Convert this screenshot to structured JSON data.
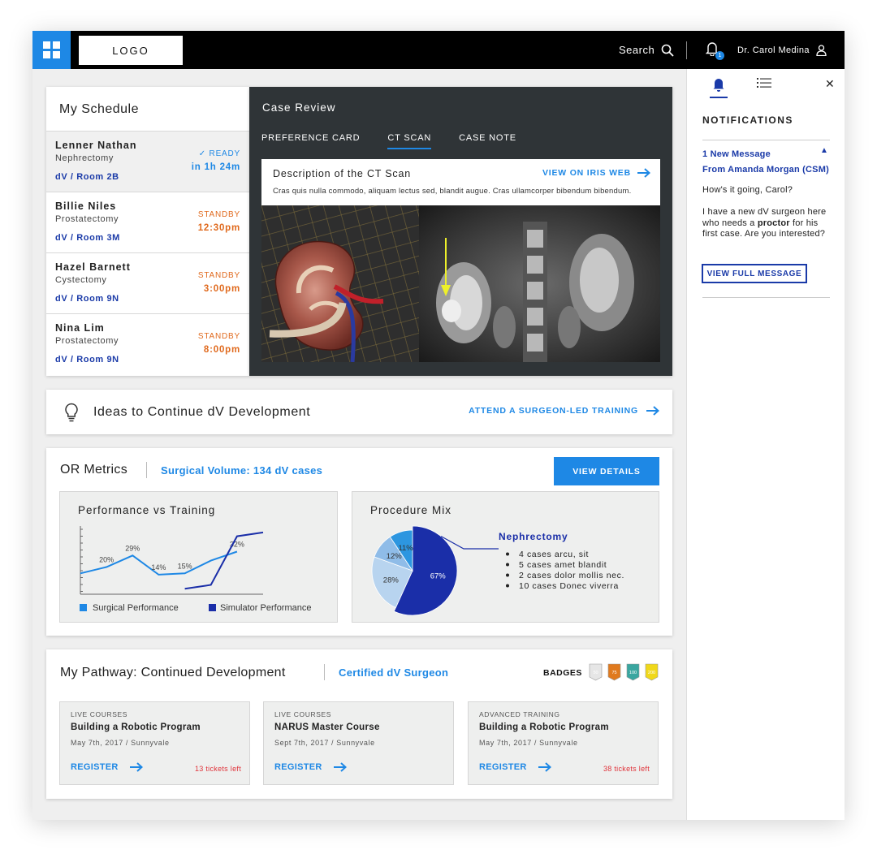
{
  "topbar": {
    "logo": "LOGO",
    "search_label": "Search",
    "notification_count": "1",
    "user_name": "Dr. Carol Medina"
  },
  "schedule": {
    "title": "My Schedule",
    "items": [
      {
        "name": "Lenner Nathan",
        "procedure": "Nephrectomy",
        "room": "dV / Room 2B",
        "status": "READY",
        "time": "in 1h 24m"
      },
      {
        "name": "Billie Niles",
        "procedure": "Prostatectomy",
        "room": "dV / Room 3M",
        "status": "STANDBY",
        "time": "12:30pm"
      },
      {
        "name": "Hazel Barnett",
        "procedure": "Cystectomy",
        "room": "dV / Room 9N",
        "status": "STANDBY",
        "time": "3:00pm"
      },
      {
        "name": "Nina Lim",
        "procedure": "Prostatectomy",
        "room": "dV / Room 9N",
        "status": "STANDBY",
        "time": "8:00pm"
      }
    ]
  },
  "case_review": {
    "title": "Case Review",
    "tabs": [
      "PREFERENCE CARD",
      "CT SCAN",
      "CASE NOTE"
    ],
    "active_tab": "CT SCAN",
    "desc_title": "Description of the CT Scan",
    "desc_link": "VIEW ON IRIS WEB",
    "desc_body": "Cras quis nulla commodo, aliquam lectus sed, blandit augue. Cras ullamcorper bibendum bibendum."
  },
  "ideas": {
    "title": "Ideas to Continue dV Development",
    "link": "ATTEND A SURGEON-LED TRAINING"
  },
  "metrics": {
    "title": "OR Metrics",
    "surgical_volume": "Surgical Volume: 134 dV cases",
    "button": "VIEW DETAILS",
    "line_title": "Performance vs Training",
    "pie_title": "Procedure Mix",
    "legend": [
      "Surgical Performance",
      "Simulator Performance"
    ],
    "pie_focus": "Nephrectomy",
    "pie_bullets": [
      "4 cases arcu, sit",
      "5 cases amet blandit",
      "2 cases dolor mollis nec.",
      "10 cases Donec viverra"
    ],
    "colors": {
      "surgical": "#1e88e5",
      "simulator": "#1a2ea8",
      "accent": "#1e88e5"
    }
  },
  "chart_data": [
    {
      "type": "line",
      "title": "Performance vs Training",
      "x": [
        1,
        2,
        3,
        4,
        5,
        6,
        7,
        8
      ],
      "series": [
        {
          "name": "Surgical Performance",
          "values": [
            15,
            20,
            29,
            14,
            15,
            25,
            32,
            null
          ],
          "labels": [
            "",
            "20%",
            "29%",
            "14%",
            "15%",
            "",
            "32%",
            ""
          ]
        },
        {
          "name": "Simulator Performance",
          "values": [
            null,
            null,
            null,
            null,
            3,
            6,
            44,
            47
          ]
        }
      ],
      "ylim": [
        0,
        52
      ],
      "grid": false,
      "legend": "bottom"
    },
    {
      "type": "pie",
      "title": "Procedure Mix",
      "slices": [
        {
          "label": "67%",
          "value": 67,
          "color": "#1a2ea8"
        },
        {
          "label": "28%",
          "value": 28,
          "color": "#b8d4ef"
        },
        {
          "label": "12%",
          "value": 12,
          "color": "#8fbce8"
        },
        {
          "label": "11%",
          "value": 11,
          "color": "#2d96e0"
        }
      ]
    }
  ],
  "pathway": {
    "title": "My Pathway: Continued Development",
    "certification": "Certified dV Surgeon",
    "badges_label": "BADGES",
    "badges": [
      {
        "label": "50",
        "color": "#e6e6e6"
      },
      {
        "label": "75",
        "color": "#e07a1e"
      },
      {
        "label": "100",
        "color": "#3aa6a0"
      },
      {
        "label": "200",
        "color": "#f0d81a"
      }
    ],
    "courses": [
      {
        "type": "LIVE COURSES",
        "name": "Building a Robotic Program",
        "date": "May 7th, 2017  /  Sunnyvale",
        "register": "REGISTER",
        "tickets": "13 tickets left"
      },
      {
        "type": "LIVE COURSES",
        "name": "NARUS Master Course",
        "date": "Sept 7th, 2017  /  Sunnyvale",
        "register": "REGISTER",
        "tickets": ""
      },
      {
        "type": "ADVANCED TRAINING",
        "name": "Building a Robotic Program",
        "date": "May 7th, 2017  /  Sunnyvale",
        "register": "REGISTER",
        "tickets": "38 tickets left"
      }
    ]
  },
  "notifications": {
    "heading": "NOTIFICATIONS",
    "new_message": "1 New Message",
    "from": "From Amanda Morgan (CSM)",
    "greeting": "How's it going, Carol?",
    "body_pre": "I have a new dV surgeon here who needs a ",
    "body_bold": "proctor",
    "body_post": " for his first case. Are you interested?",
    "button": "VIEW FULL MESSAGE"
  }
}
